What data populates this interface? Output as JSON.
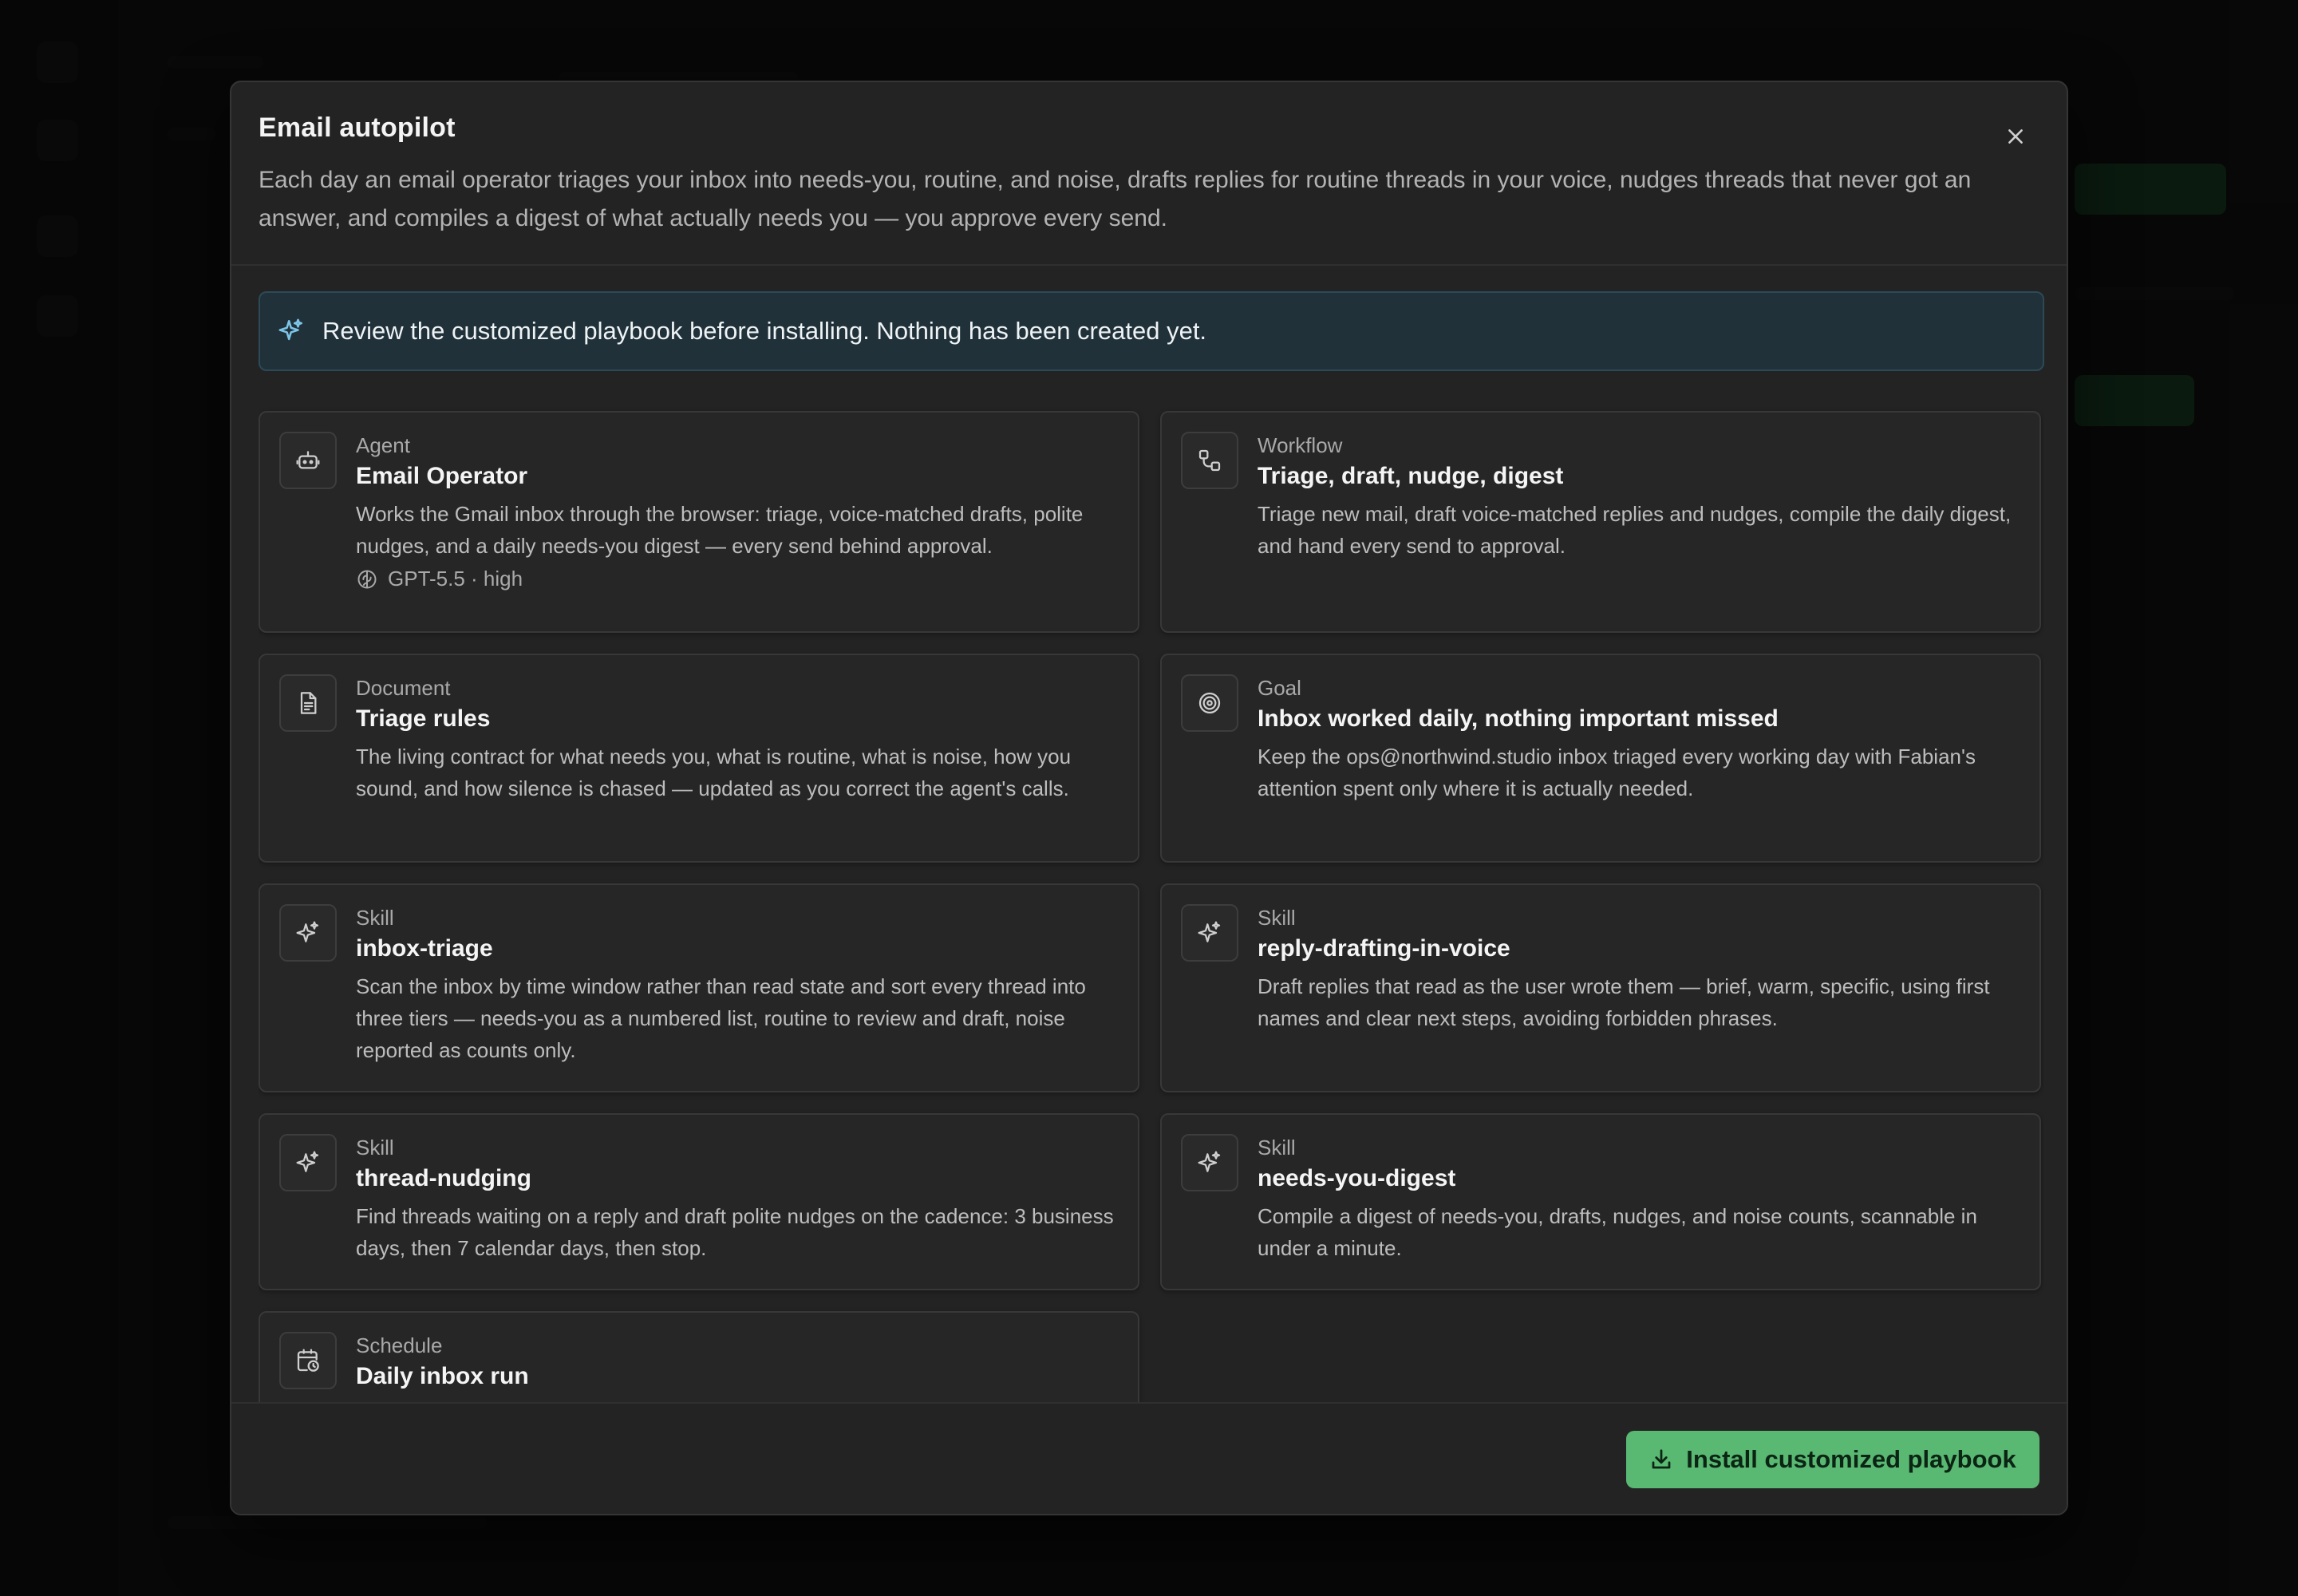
{
  "modal": {
    "title": "Email autopilot",
    "description": "Each day an email operator triages your inbox into needs-you, routine, and noise, drafts replies for routine threads in your voice, nudges threads that never got an answer, and compiles a digest of what actually needs you — you approve every send."
  },
  "banner": {
    "text": "Review the customized playbook before installing. Nothing has been created yet."
  },
  "cards": [
    {
      "type": "Agent",
      "title": "Email Operator",
      "description": "Works the Gmail inbox through the browser: triage, voice-matched drafts, polite nudges, and a daily needs-you digest — every send behind approval.",
      "meta": "GPT-5.5 · high",
      "icon": "robot-icon"
    },
    {
      "type": "Workflow",
      "title": "Triage, draft, nudge, digest",
      "description": "Triage new mail, draft voice-matched replies and nudges, compile the daily digest, and hand every send to approval.",
      "icon": "workflow-icon"
    },
    {
      "type": "Document",
      "title": "Triage rules",
      "description": "The living contract for what needs you, what is routine, what is noise, how you sound, and how silence is chased — updated as you correct the agent's calls.",
      "icon": "document-icon"
    },
    {
      "type": "Goal",
      "title": "Inbox worked daily, nothing important missed",
      "description": "Keep the ops@northwind.studio inbox triaged every working day with Fabian's attention spent only where it is actually needed.",
      "icon": "target-icon"
    },
    {
      "type": "Skill",
      "title": "inbox-triage",
      "description": "Scan the inbox by time window rather than read state and sort every thread into three tiers — needs-you as a numbered list, routine to review and draft, noise reported as counts only.",
      "icon": "sparkle-icon"
    },
    {
      "type": "Skill",
      "title": "reply-drafting-in-voice",
      "description": "Draft replies that read as the user wrote them — brief, warm, specific, using first names and clear next steps, avoiding forbidden phrases.",
      "icon": "sparkle-icon"
    },
    {
      "type": "Skill",
      "title": "thread-nudging",
      "description": "Find threads waiting on a reply and draft polite nudges on the cadence: 3 business days, then 7 calendar days, then stop.",
      "icon": "sparkle-icon"
    },
    {
      "type": "Skill",
      "title": "needs-you-digest",
      "description": "Compile a digest of needs-you, drafts, nudges, and noise counts, scannable in under a minute.",
      "icon": "sparkle-icon"
    },
    {
      "type": "Schedule",
      "title": "Daily inbox run",
      "icon": "calendar-clock-icon"
    }
  ],
  "footer": {
    "install_label": "Install customized playbook"
  },
  "colors": {
    "accent_green": "#59b871",
    "banner_bg": "#213139",
    "banner_icon": "#7cc4e8"
  }
}
